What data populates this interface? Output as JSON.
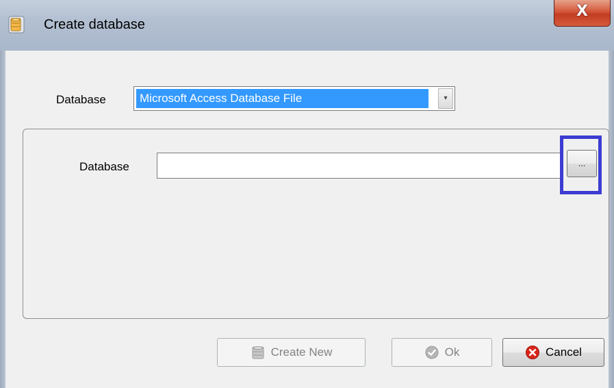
{
  "window": {
    "title": "Create database",
    "close_glyph": "X",
    "title_icon": "database-icon"
  },
  "provider": {
    "label": "Database",
    "selected": "Microsoft Access Database File",
    "arrow_glyph": "▾"
  },
  "file": {
    "label": "Database",
    "value": "",
    "browse_label": "..."
  },
  "buttons": {
    "create_new": {
      "label": "Create New",
      "icon": "database-icon",
      "enabled": false
    },
    "ok": {
      "label": "Ok",
      "icon": "check-circle-icon",
      "enabled": false
    },
    "cancel": {
      "label": "Cancel",
      "icon": "close-circle-icon",
      "enabled": true
    }
  },
  "colors": {
    "selection": "#3399ff",
    "highlight_box": "#3c3cd2",
    "cancel_icon": "#d9261c"
  }
}
